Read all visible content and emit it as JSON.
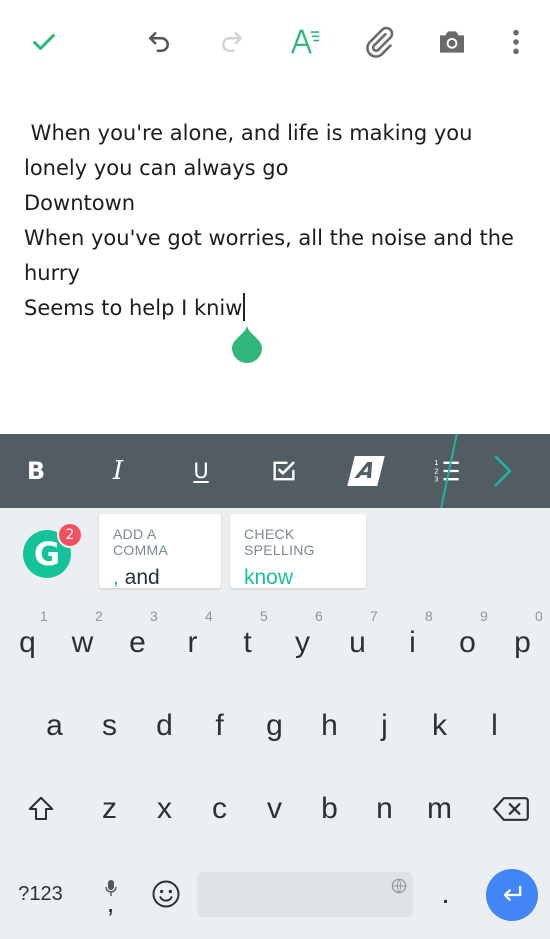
{
  "colors": {
    "accent_green": "#15c39a",
    "toolbar_icon_green": "#2fb77a",
    "format_bar_bg": "#525c63",
    "keyboard_bg": "#eceff1",
    "enter_blue": "#4285f4",
    "badge_red": "#f2505d"
  },
  "toolbar": {
    "icons": [
      "check-icon",
      "undo-icon",
      "redo-icon",
      "text-format-icon",
      "attach-icon",
      "camera-icon",
      "more-vert-icon"
    ]
  },
  "editor": {
    "lines": [
      " When you're alone, and life is making you",
      "lonely you can always go",
      "Downtown",
      "When you've got worries, all the noise and the",
      "hurry",
      "Seems to help I kniw"
    ]
  },
  "format_bar": {
    "bold": "B",
    "italic": "I",
    "underline": "U",
    "text_style": "A"
  },
  "grammarly": {
    "badge_count": "2",
    "logo": "G",
    "cards": [
      {
        "title": "ADD A COMMA",
        "accent": ",",
        "text": " and"
      },
      {
        "title": "CHECK SPELLING",
        "accent": "know",
        "text": ""
      }
    ]
  },
  "keyboard": {
    "row1": [
      "q",
      "w",
      "e",
      "r",
      "t",
      "y",
      "u",
      "i",
      "o",
      "p"
    ],
    "row1_hints": [
      "1",
      "2",
      "3",
      "4",
      "5",
      "6",
      "7",
      "8",
      "9",
      "0"
    ],
    "row2": [
      "a",
      "s",
      "d",
      "f",
      "g",
      "h",
      "j",
      "k",
      "l"
    ],
    "row3": [
      "z",
      "x",
      "c",
      "v",
      "b",
      "n",
      "m"
    ],
    "symbols_key": "?123",
    "comma_key": ",",
    "period_key": "."
  }
}
